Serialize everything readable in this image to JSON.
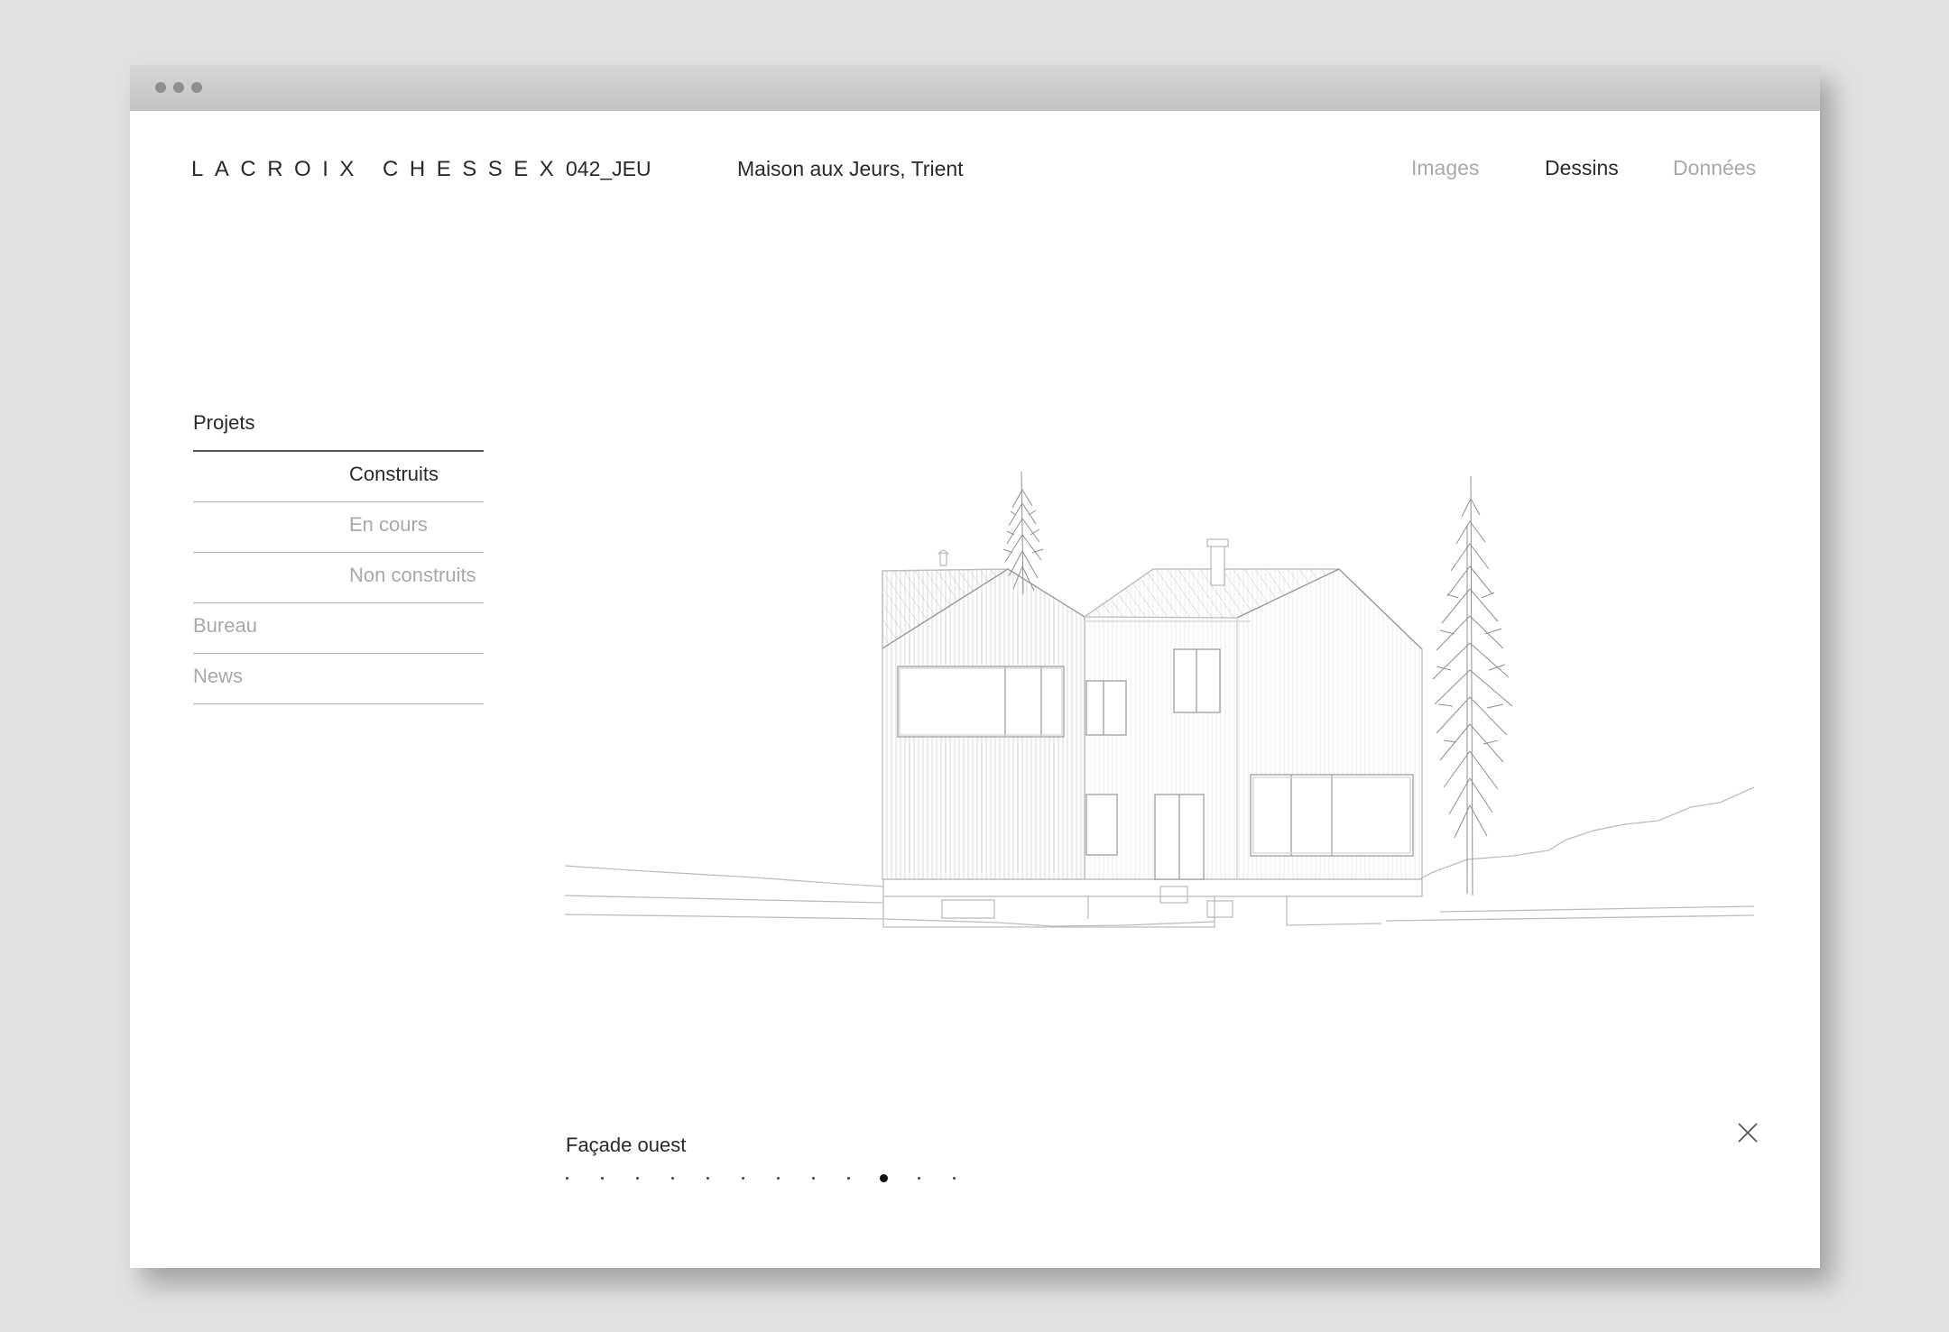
{
  "header": {
    "logo": "LACROIX CHESSEX",
    "project_code": "042_JEU",
    "project_title": "Maison aux Jeurs, Trient"
  },
  "tabs": [
    {
      "label": "Images",
      "active": false
    },
    {
      "label": "Dessins",
      "active": true
    },
    {
      "label": "Données",
      "active": false
    }
  ],
  "nav": {
    "projects_label": "Projets",
    "sub_items": [
      {
        "label": "Construits",
        "current": true
      },
      {
        "label": "En cours",
        "current": false
      },
      {
        "label": "Non construits",
        "current": false
      }
    ],
    "main_items": [
      {
        "label": "Bureau"
      },
      {
        "label": "News"
      }
    ]
  },
  "viewer": {
    "caption": "Façade ouest",
    "total_slides": 12,
    "current_slide": 10
  },
  "icons": {
    "close": "close-icon",
    "drawing": "facade-drawing"
  }
}
